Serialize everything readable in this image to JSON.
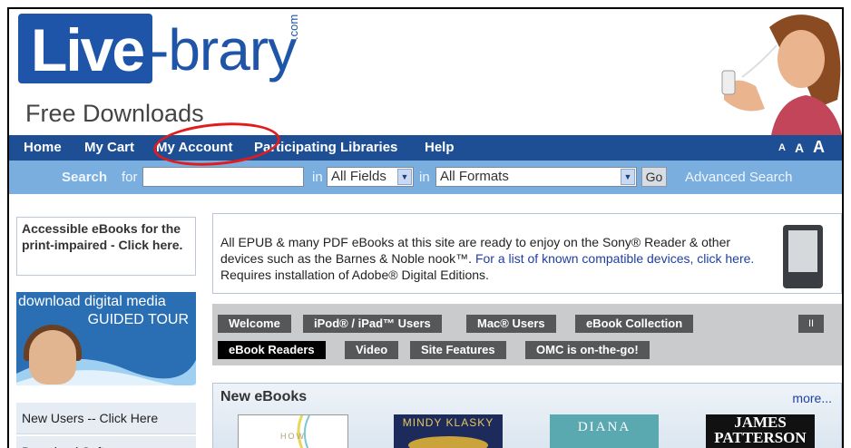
{
  "header": {
    "logo_live": "Live",
    "logo_rest": "-brary",
    "logo_com": ".com",
    "tagline": "Free Downloads"
  },
  "nav": {
    "items": [
      "Home",
      "My Cart",
      "My Account",
      "Participating Libraries",
      "Help"
    ],
    "font_sizes": [
      "A",
      "A",
      "A"
    ]
  },
  "search": {
    "label": "Search",
    "for": "for",
    "in1": "in",
    "field_select": "All Fields",
    "in2": "in",
    "format_select": "All Formats",
    "go": "Go",
    "advanced": "Advanced Search",
    "query_value": ""
  },
  "sidebar": {
    "accessible": "Accessible eBooks for the print-impaired - Click here.",
    "tour_line1": "download digital media",
    "tour_line2": "GUIDED TOUR",
    "links": [
      "New Users -- Click Here",
      "Download Software"
    ]
  },
  "info": {
    "text_before": "All EPUB & many PDF eBooks at this site are ready to enjoy on the Sony® Reader & other devices such as the Barnes & Noble nook™.",
    "link": "For a list of known compatible devices, click here.",
    "text_after": "Requires installation of Adobe® Digital Editions."
  },
  "tabs": {
    "row1": [
      "Welcome",
      "iPod® / iPad™ Users",
      "Mac® Users",
      "eBook Collection"
    ],
    "row2": [
      "eBook Readers",
      "Video",
      "Site Features",
      "OMC is on-the-go!"
    ],
    "active": "eBook Readers",
    "pause": "II"
  },
  "new_ebooks": {
    "title": "New eBooks",
    "more": "more...",
    "books": [
      {
        "label": "HOW",
        "color": "#ffffff",
        "text_color": "#b0a070"
      },
      {
        "label": "MINDY KLASKY",
        "color": "#1c2a5c",
        "text_color": "#e6c85a"
      },
      {
        "label": "DIANA",
        "color": "#5aa8b0",
        "text_color": "#ffffff"
      },
      {
        "label": "JAMES PATTERSON",
        "color": "#111111",
        "text_color": "#ffffff"
      }
    ]
  },
  "colors": {
    "brand_blue": "#1e55a8",
    "nav_bg": "#1e4f95",
    "search_bg": "#79aede",
    "annotation": "#e21b1b"
  }
}
